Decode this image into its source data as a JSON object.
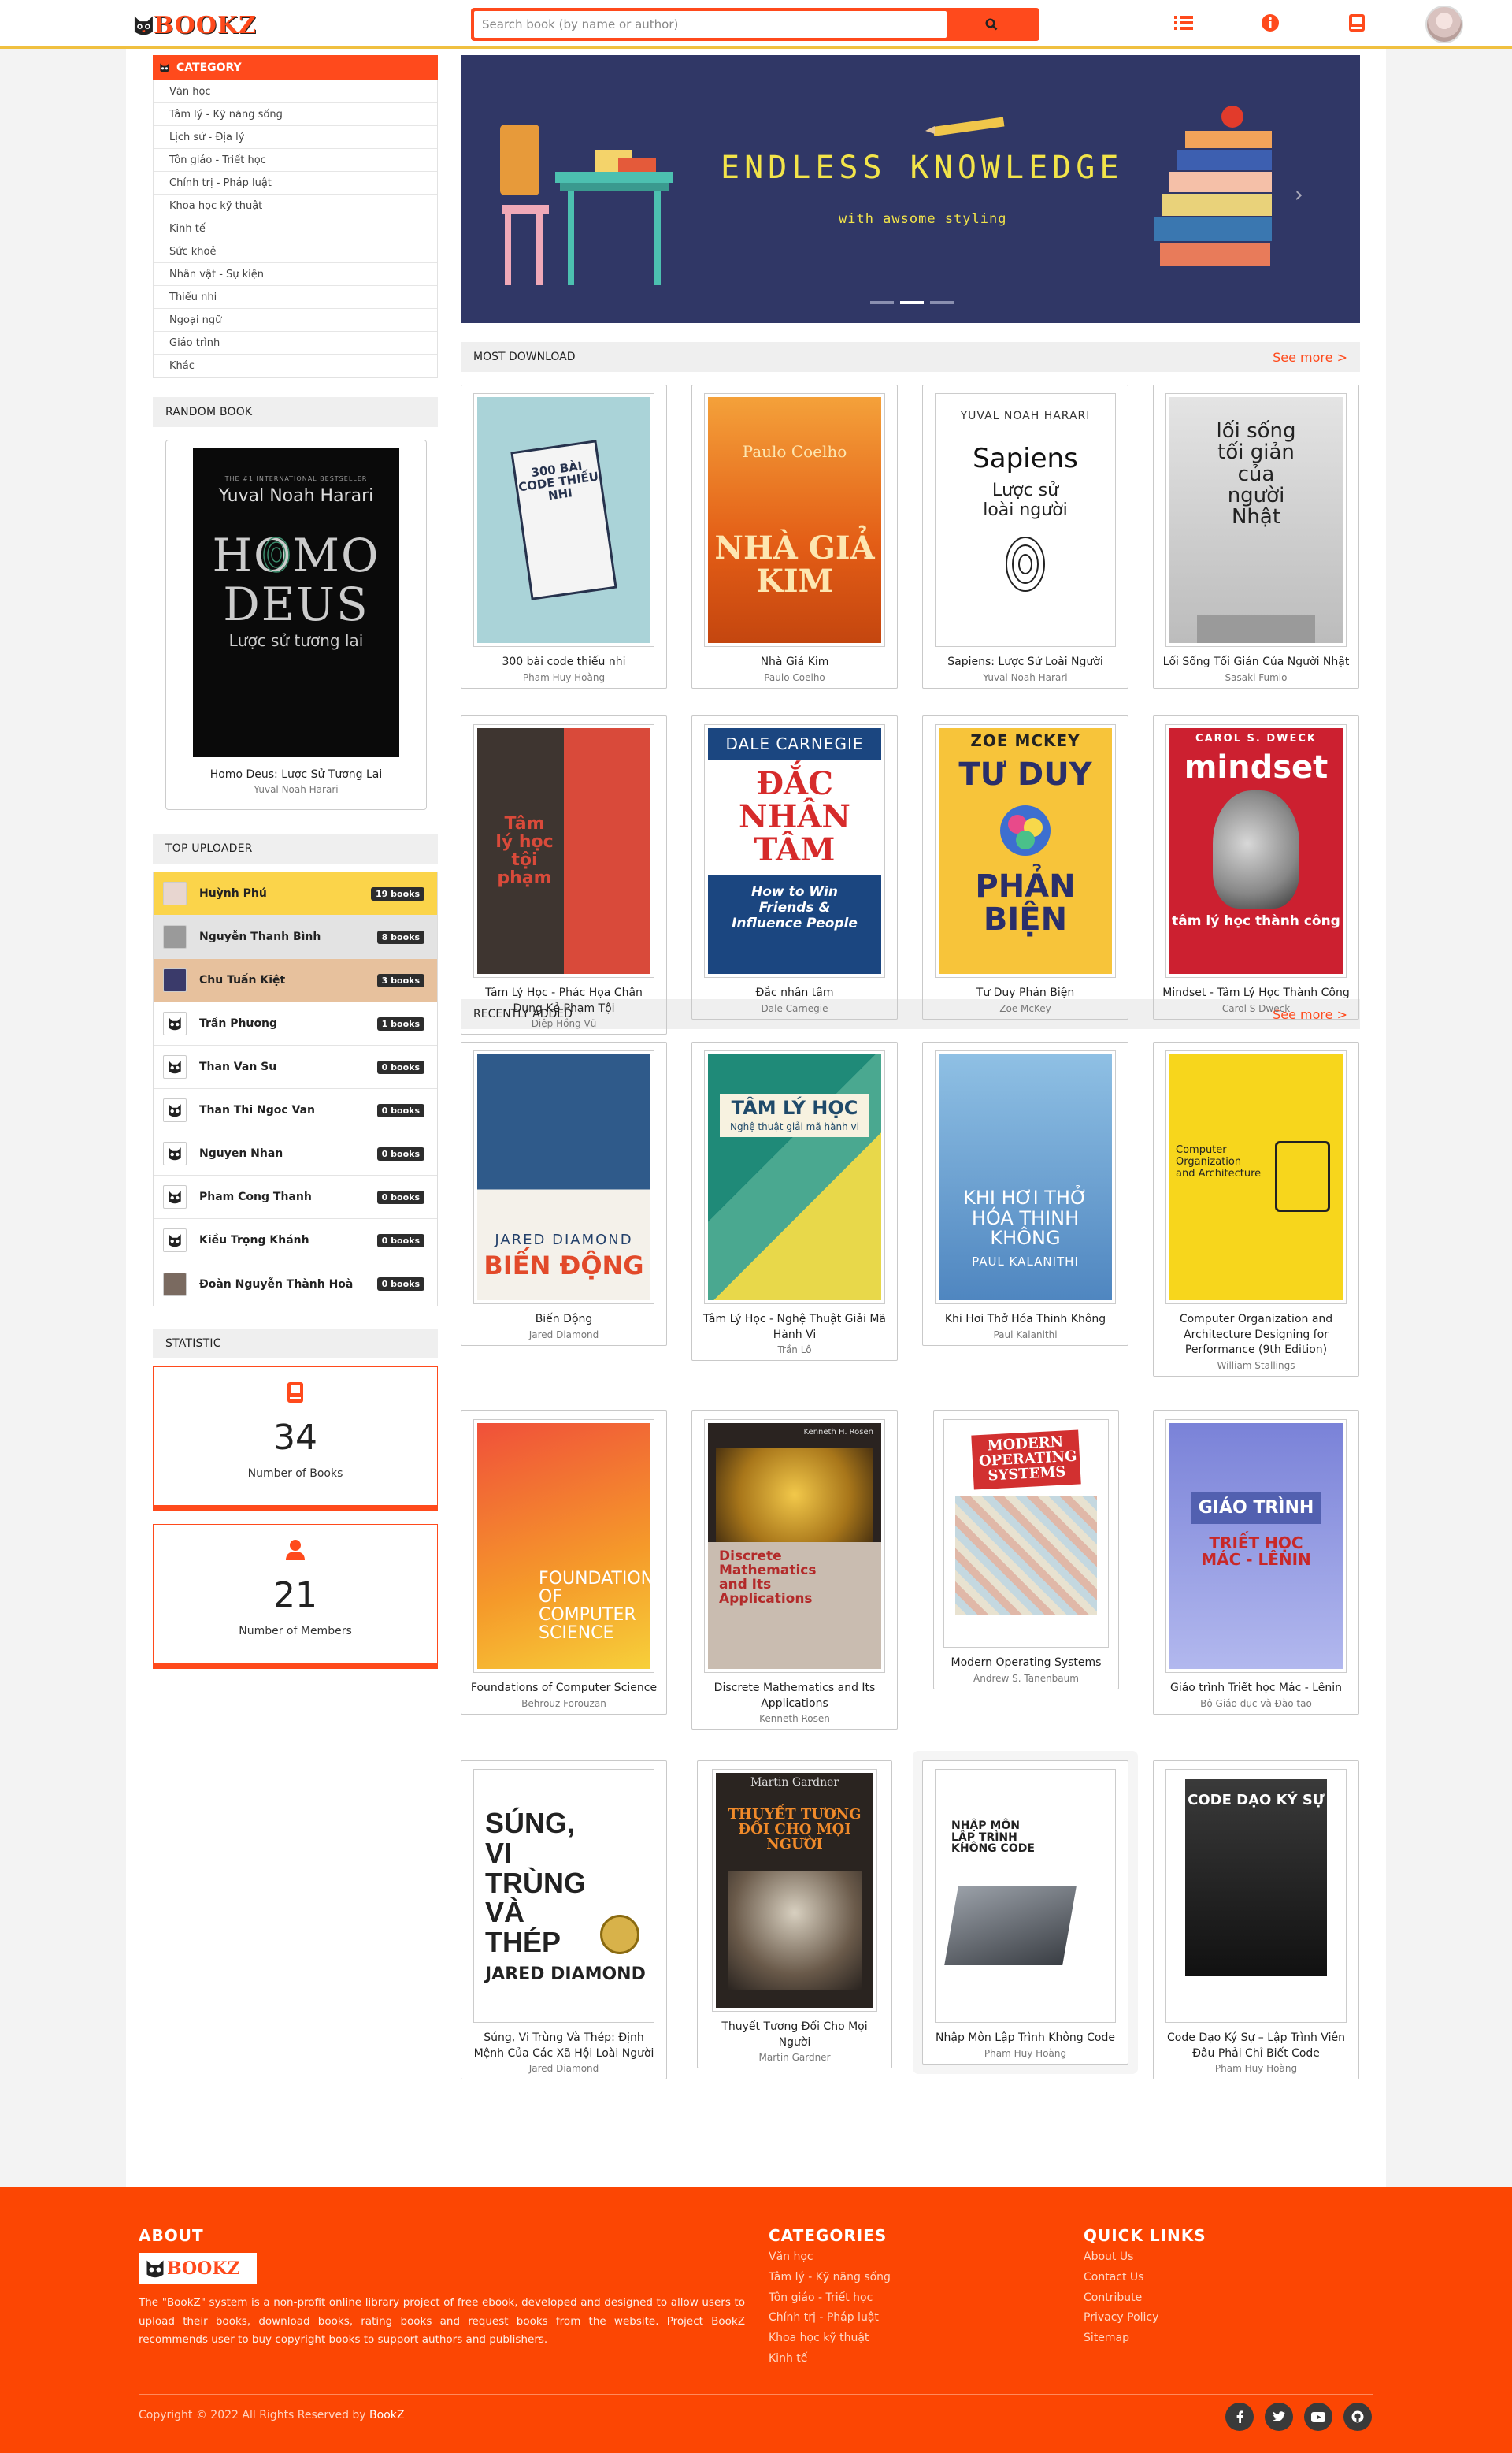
{
  "header": {
    "logo_text": "BOOKZ",
    "search_placeholder": "Search book (by name or author)",
    "icons": [
      "list-icon",
      "info-icon",
      "book-icon",
      "avatar"
    ]
  },
  "sidebar": {
    "category_title": "CATEGORY",
    "categories": [
      "Văn học",
      "Tâm lý - Kỹ năng sống",
      "Lịch sử - Địa lý",
      "Tôn giáo - Triết học",
      "Chính trị - Pháp luật",
      "Khoa học kỹ thuật",
      "Kinh tế",
      "Sức khoẻ",
      "Nhân vật - Sự kiện",
      "Thiếu nhi",
      "Ngoại ngữ",
      "Giáo trình",
      "Khác"
    ],
    "random_title": "RANDOM BOOK",
    "random_book": {
      "cover_top": "THE #1 INTERNATIONAL BESTSELLER",
      "cover_author": "Yuval Noah Harari",
      "cover_title_1": "HOMO",
      "cover_title_2": "DEUS",
      "cover_sub": "Lược sử tương lai",
      "title": "Homo Deus: Lược Sử Tương Lai",
      "author": "Yuval Noah Harari"
    },
    "uploader_title": "TOP UPLOADER",
    "uploaders": [
      {
        "name": "Huỳnh Phú",
        "count": "19 books"
      },
      {
        "name": "Nguyễn Thanh Bình",
        "count": "8 books"
      },
      {
        "name": "Chu Tuấn Kiệt",
        "count": "3 books"
      },
      {
        "name": "Trần Phương",
        "count": "1 books"
      },
      {
        "name": "Than Van Su",
        "count": "0 books"
      },
      {
        "name": "Than Thi Ngoc Van",
        "count": "0 books"
      },
      {
        "name": "Nguyen Nhan",
        "count": "0 books"
      },
      {
        "name": "Pham Cong Thanh",
        "count": "0 books"
      },
      {
        "name": "Kiều Trọng Khánh",
        "count": "0 books"
      },
      {
        "name": "Đoàn Nguyễn Thành Hoà",
        "count": "0 books"
      }
    ],
    "statistic_title": "STATISTIC",
    "stats": [
      {
        "value": "34",
        "label": "Number of Books"
      },
      {
        "value": "21",
        "label": "Number of Members"
      }
    ]
  },
  "banner": {
    "title": "ENDLESS KNOWLEDGE",
    "subtitle": "with awsome styling"
  },
  "most_download": {
    "title": "MOST DOWNLOAD",
    "see_more": "See more >",
    "books": [
      {
        "title": "300 bài code thiếu nhi",
        "author": "Pham Huy Hoàng",
        "cover": "300 BÀI CODE THIẾU NHI"
      },
      {
        "title": "Nhà Giả Kim",
        "author": "Paulo Coelho",
        "cover": "NHÀ GIẢ KIM",
        "cover_top": "Paulo Coelho"
      },
      {
        "title": "Sapiens: Lược Sử Loài Người",
        "author": "Yuval Noah Harari",
        "cover": "Sapiens",
        "cover_top": "YUVAL NOAH HARARI",
        "cover_sub": "Lược sử loài người"
      },
      {
        "title": "Lối Sống Tối Giản Của Người Nhật",
        "author": "Sasaki Fumio",
        "cover": "lối sống tối giản của người Nhật"
      },
      {
        "title": "Tâm Lý Học - Phác Họa Chân Dung Kẻ Phạm Tội",
        "author": "Diệp Hồng Vũ",
        "cover": "Tâm lý học tội phạm"
      },
      {
        "title": "Đắc nhân tâm",
        "author": "Dale Carnegie",
        "cover": "ĐẮC NHÂN TÂM",
        "cover_top": "DALE CARNEGIE",
        "cover_sub": "How to Win Friends & Influence People"
      },
      {
        "title": "Tư Duy Phản Biện",
        "author": "Zoe McKey",
        "cover_1": "TƯ DUY",
        "cover_2": "PHẢN BIỆN",
        "cover_top": "ZOE MCKEY"
      },
      {
        "title": "Mindset - Tâm Lý Học Thành Công",
        "author": "Carol S Dweck",
        "cover": "mindset",
        "cover_top": "CAROL S. DWECK",
        "cover_sub": "tâm lý học thành công"
      }
    ]
  },
  "recently_added": {
    "title": "RECENTLY ADDED",
    "see_more": "See more >",
    "books": [
      {
        "title": "Biến Động",
        "author": "Jared Diamond",
        "cover": "BIẾN ĐỘNG",
        "cover_top": "JARED DIAMOND"
      },
      {
        "title": "Tâm Lý Học - Nghệ Thuật Giải Mã Hành Vi",
        "author": "Trần Lô",
        "cover": "TÂM LÝ HỌC",
        "cover_sub": "Nghệ thuật giải mã hành vi"
      },
      {
        "title": "Khi Hơi Thở Hóa Thinh Không",
        "author": "Paul Kalanithi",
        "cover": "KHI HƠI THỞ HÓA THINH KHÔNG",
        "cover_sub": "PAUL KALANITHI"
      },
      {
        "title": "Computer Organization and Architecture Designing for Performance (9th Edition)",
        "author": "William Stallings",
        "cover": "Computer Organization and Architecture"
      },
      {
        "title": "Foundations of Computer Science",
        "author": "Behrouz Forouzan",
        "cover": "FOUNDATIONS OF COMPUTER SCIENCE"
      },
      {
        "title": "Discrete Mathematics and Its Applications",
        "author": "Kenneth Rosen",
        "cover": "Discrete Mathematics and Its Applications",
        "cover_top": "Kenneth H. Rosen"
      },
      {
        "title": "Modern Operating Systems",
        "author": "Andrew S. Tanenbaum",
        "cover": "MODERN OPERATING SYSTEMS"
      },
      {
        "title": "Giáo trình Triết học Mác - Lênin",
        "author": "Bộ Giáo dục và Đào tạo",
        "cover_1": "GIÁO TRÌNH",
        "cover_2": "TRIẾT HỌC MÁC - LÊNIN"
      },
      {
        "title": "Súng, Vi Trùng Và Thép: Định Mệnh Của Các Xã Hội Loài Người",
        "author": "Jared Diamond",
        "cover": "SÚNG, VI TRÙNG VÀ THÉP",
        "cover_sub": "JARED DIAMOND"
      },
      {
        "title": "Thuyết Tương Đối Cho Mọi Người",
        "author": "Martin Gardner",
        "cover": "THUYẾT TƯƠNG ĐỐI CHO MỌI NGƯỜI",
        "cover_top": "Martin Gardner"
      },
      {
        "title": "Nhập Môn Lập Trình Không Code",
        "author": "Pham Huy Hoàng",
        "cover": "NHẬP MÔN LẬP TRÌNH KHÔNG CODE"
      },
      {
        "title": "Code Dạo Ký Sự – Lập Trình Viên Đâu Phải Chỉ Biết Code",
        "author": "Pham Huy Hoàng",
        "cover": "CODE DẠO KÝ SỰ"
      }
    ]
  },
  "footer": {
    "about_title": "ABOUT",
    "about_text": "The \"BookZ\" system is a non-profit online library project of free ebook, developed and designed to allow users to upload their books, download books, rating books and request books from the website. Project BookZ recommends user to buy copyright books to support authors and publishers.",
    "categories_title": "CATEGORIES",
    "categories": [
      "Văn học",
      "Tâm lý - Kỹ năng sống",
      "Tôn giáo - Triết học",
      "Chính trị - Pháp luật",
      "Khoa học kỹ thuật",
      "Kinh tế"
    ],
    "links_title": "QUICK LINKS",
    "links": [
      "About Us",
      "Contact Us",
      "Contribute",
      "Privacy Policy",
      "Sitemap"
    ],
    "copyright": "Copyright © 2022 All Rights Reserved by",
    "brand": "BookZ",
    "social": [
      "facebook-icon",
      "twitter-icon",
      "youtube-icon",
      "github-icon"
    ]
  },
  "colors": {
    "accent": "#ff4a1c",
    "banner": "#303766",
    "footer": "#fc4603",
    "gold": "#fbd44a"
  }
}
